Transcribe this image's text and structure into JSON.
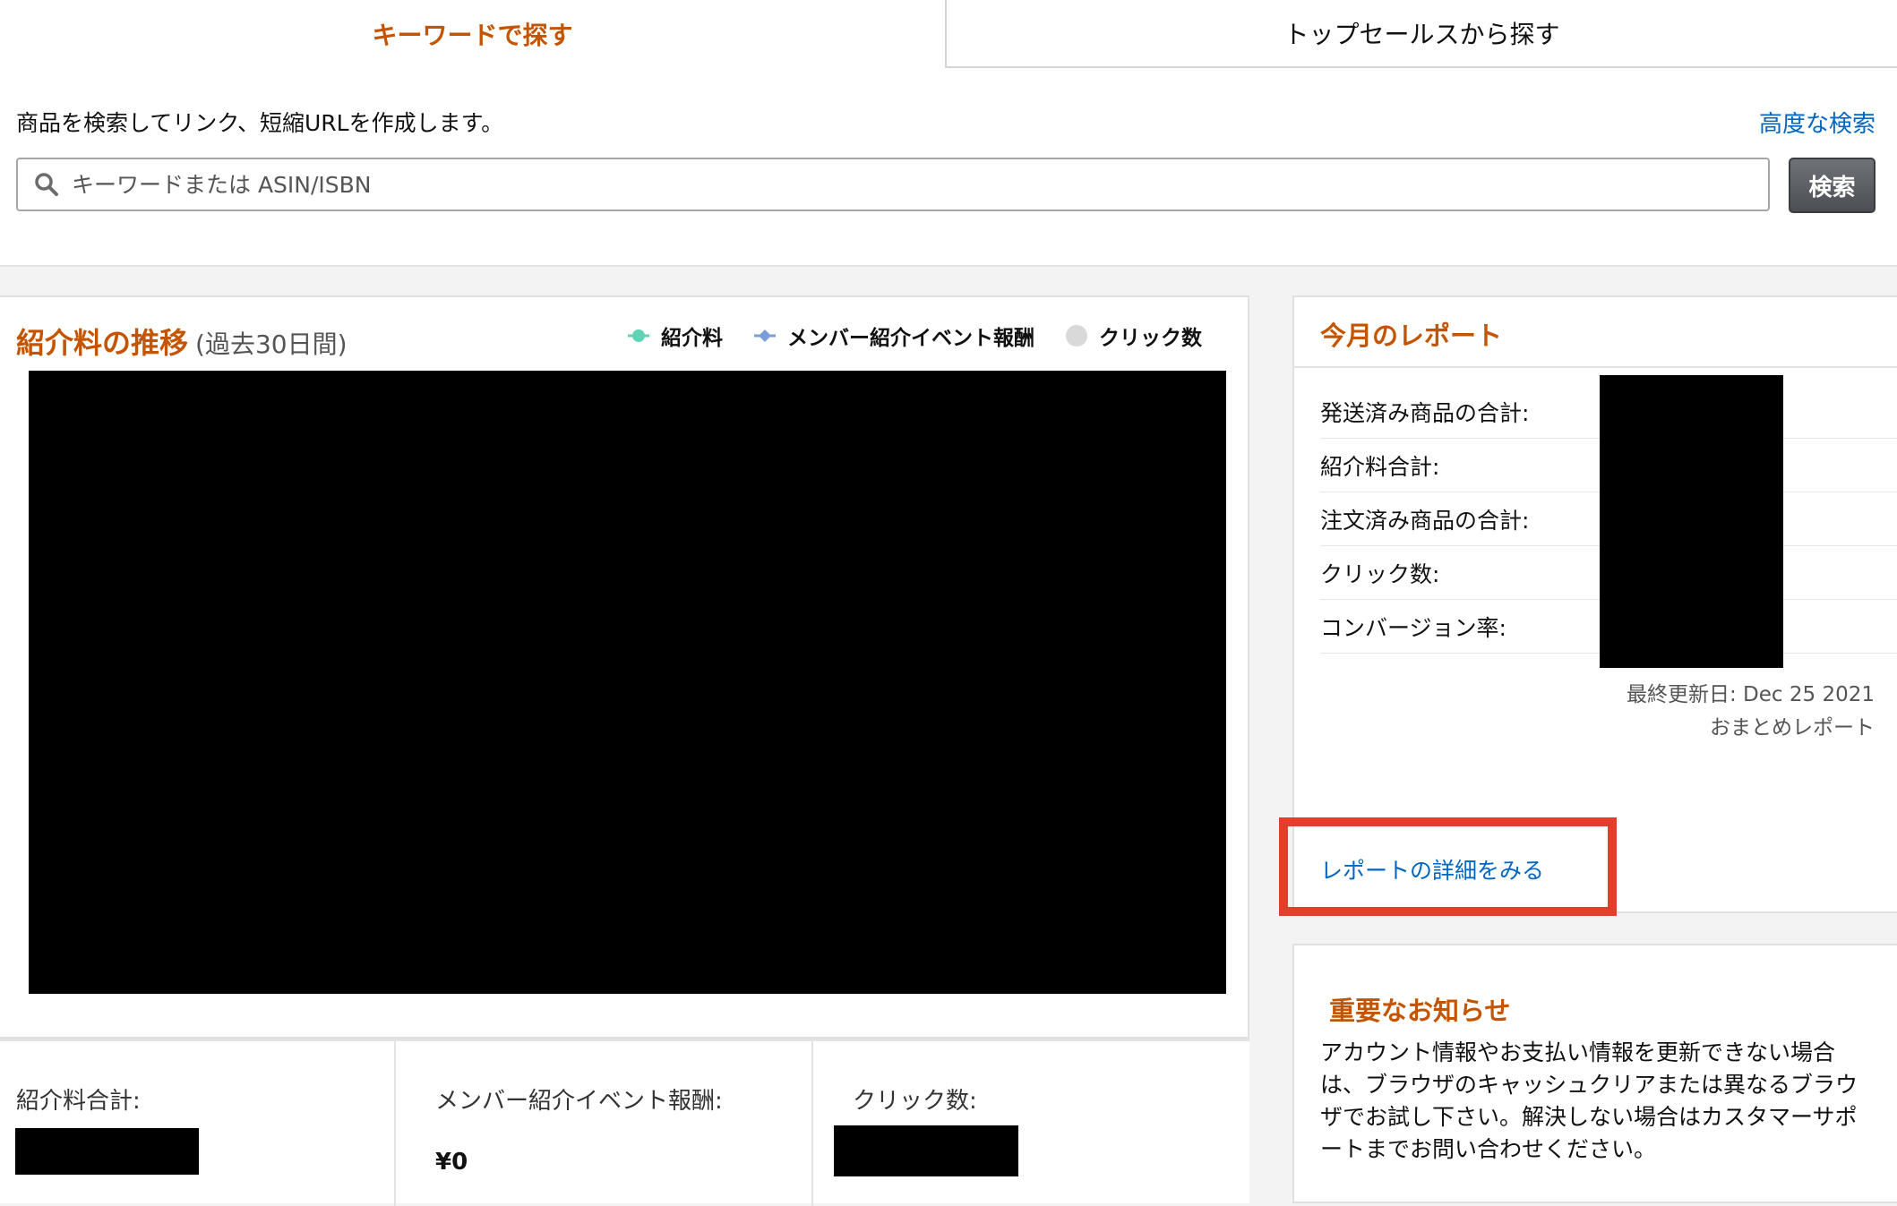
{
  "tabs": {
    "keyword_label": "キーワードで探す",
    "topsales_label": "トップセールスから探す"
  },
  "search": {
    "description": "商品を検索してリンク、短縮URLを作成します。",
    "advanced_label": "高度な検索",
    "placeholder": "キーワードまたは ASIN/ISBN",
    "button_label": "検索"
  },
  "chart": {
    "title": "紹介料の推移",
    "subtitle": "(過去30日間)",
    "legend": [
      {
        "label": "紹介料",
        "color": "#5fd3b3"
      },
      {
        "label": "メンバー紹介イベント報酬",
        "color": "#7a9fd8"
      },
      {
        "label": "クリック数",
        "color": "#d9d9d9"
      }
    ]
  },
  "totals": {
    "fees_label": "紹介料合計:",
    "member_event_label": "メンバー紹介イベント報酬:",
    "member_event_value": "¥0",
    "clicks_label": "クリック数:"
  },
  "report": {
    "title": "今月のレポート",
    "rows": [
      "発送済み商品の合計:",
      "紹介料合計:",
      "注文済み商品の合計:",
      "クリック数:",
      "コンバージョン率:"
    ],
    "last_updated": "最終更新日: Dec 25 2021",
    "summary_label": "おまとめレポート",
    "detail_link": "レポートの詳細をみる"
  },
  "notice": {
    "title": "重要なお知らせ",
    "body": "アカウント情報やお支払い情報を更新できない場合は、ブラウザのキャッシュクリアまたは異なるブラウザでお試し下さい。解決しない場合はカスタマーサポートまでお問い合わせください。"
  }
}
